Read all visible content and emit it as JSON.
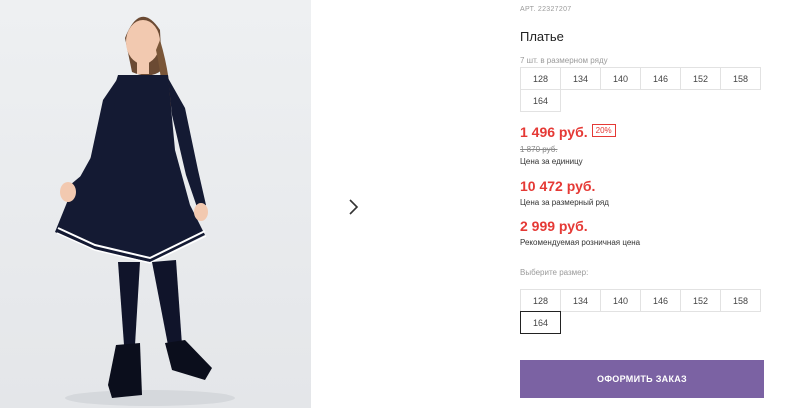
{
  "product": {
    "article": "АРТ. 22327207",
    "title": "Платье",
    "pack_note": "7 шт. в размерном ряду",
    "pack_sizes": [
      "128",
      "134",
      "140",
      "146",
      "152",
      "158",
      "164"
    ]
  },
  "pricing": {
    "unit_price": "1 496 руб.",
    "discount": "20%",
    "old_price": "1 870 руб.",
    "unit_caption": "Цена за единицу",
    "pack_price": "10 472 руб.",
    "pack_caption": "Цена за размерный ряд",
    "retail_price": "2 999 руб.",
    "retail_caption": "Рекомендуемая розничная цена"
  },
  "size_select": {
    "label": "Выберите размер:",
    "options": [
      "128",
      "134",
      "140",
      "146",
      "152",
      "158",
      "164"
    ],
    "selected": "164"
  },
  "actions": {
    "order_label": "ОФОРМИТЬ ЗАКАЗ"
  },
  "icons": {
    "next": "chevron-right-icon"
  },
  "colors": {
    "price_red": "#e53935",
    "button_purple": "#7b62a3"
  }
}
